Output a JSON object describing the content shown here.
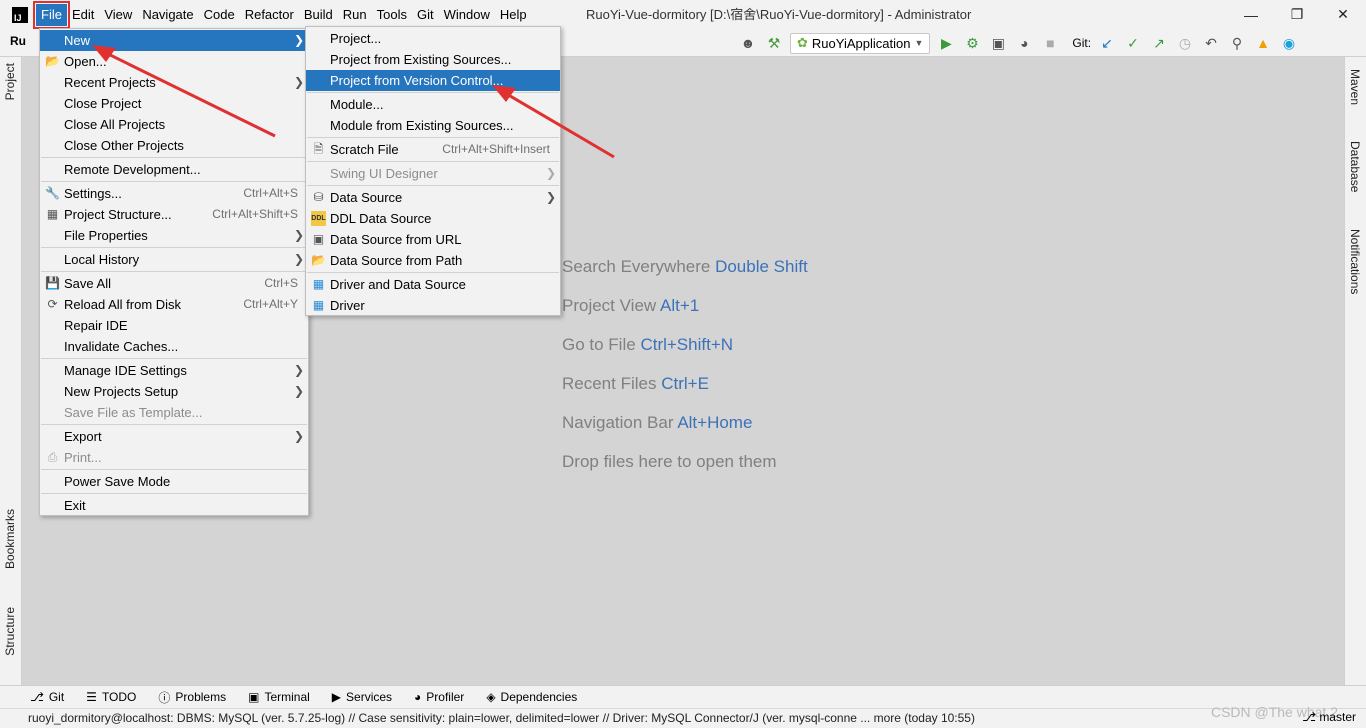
{
  "titlebar": {
    "logo": "IJ",
    "menus": [
      "File",
      "Edit",
      "View",
      "Navigate",
      "Code",
      "Refactor",
      "Build",
      "Run",
      "Tools",
      "Git",
      "Window",
      "Help"
    ],
    "window_title": "RuoYi-Vue-dormitory [D:\\宿舍\\RuoYi-Vue-dormitory] - Administrator",
    "minimize": "—",
    "restore": "❐",
    "close": "✕"
  },
  "toolbar": {
    "project_crumb": "Ru",
    "run_config": "RuoYiApplication",
    "git_label": "Git:"
  },
  "left_tabs": {
    "project": "Project",
    "bookmarks": "Bookmarks",
    "structure": "Structure"
  },
  "right_tabs": {
    "maven": "Maven",
    "database": "Database",
    "notifications": "Notifications"
  },
  "hints": [
    {
      "text": "Search Everywhere",
      "key": "Double Shift"
    },
    {
      "text": "Project View",
      "key": "Alt+1"
    },
    {
      "text": "Go to File",
      "key": "Ctrl+Shift+N"
    },
    {
      "text": "Recent Files",
      "key": "Ctrl+E"
    },
    {
      "text": "Navigation Bar",
      "key": "Alt+Home"
    },
    {
      "text": "Drop files here to open them",
      "key": ""
    }
  ],
  "file_menu": {
    "new": "New",
    "open": "Open...",
    "recent_projects": "Recent Projects",
    "close_project": "Close Project",
    "close_all_projects": "Close All Projects",
    "close_other_projects": "Close Other Projects",
    "remote_development": "Remote Development...",
    "settings": "Settings...",
    "settings_sc": "Ctrl+Alt+S",
    "project_structure": "Project Structure...",
    "project_structure_sc": "Ctrl+Alt+Shift+S",
    "file_properties": "File Properties",
    "local_history": "Local History",
    "save_all": "Save All",
    "save_all_sc": "Ctrl+S",
    "reload_all": "Reload All from Disk",
    "reload_all_sc": "Ctrl+Alt+Y",
    "repair_ide": "Repair IDE",
    "invalidate_caches": "Invalidate Caches...",
    "manage_ide_settings": "Manage IDE Settings",
    "new_projects_setup": "New Projects Setup",
    "save_file_as_template": "Save File as Template...",
    "export": "Export",
    "print": "Print...",
    "power_save_mode": "Power Save Mode",
    "exit": "Exit"
  },
  "new_menu": {
    "project": "Project...",
    "project_from_existing": "Project from Existing Sources...",
    "project_from_vcs": "Project from Version Control...",
    "module": "Module...",
    "module_from_existing": "Module from Existing Sources...",
    "scratch_file": "Scratch File",
    "scratch_file_sc": "Ctrl+Alt+Shift+Insert",
    "swing_ui_designer": "Swing UI Designer",
    "data_source": "Data Source",
    "ddl_data_source": "DDL Data Source",
    "data_source_from_url": "Data Source from URL",
    "data_source_from_path": "Data Source from Path",
    "driver_and_data_source": "Driver and Data Source",
    "driver": "Driver"
  },
  "bottom_tabs": {
    "git": "Git",
    "todo": "TODO",
    "problems": "Problems",
    "terminal": "Terminal",
    "services": "Services",
    "profiler": "Profiler",
    "dependencies": "Dependencies"
  },
  "status": {
    "text": "ruoyi_dormitory@localhost: DBMS: MySQL (ver. 5.7.25-log) // Case sensitivity: plain=lower, delimited=lower // Driver: MySQL Connector/J (ver. mysql-conne ... more (today 10:55)",
    "branch": "master",
    "watermark": "CSDN @The what 2"
  },
  "colors": {
    "selection": "#2675bf",
    "highlight_box": "#e0302f",
    "arrow": "#e0302f",
    "hint_key": "#3b72b8"
  }
}
